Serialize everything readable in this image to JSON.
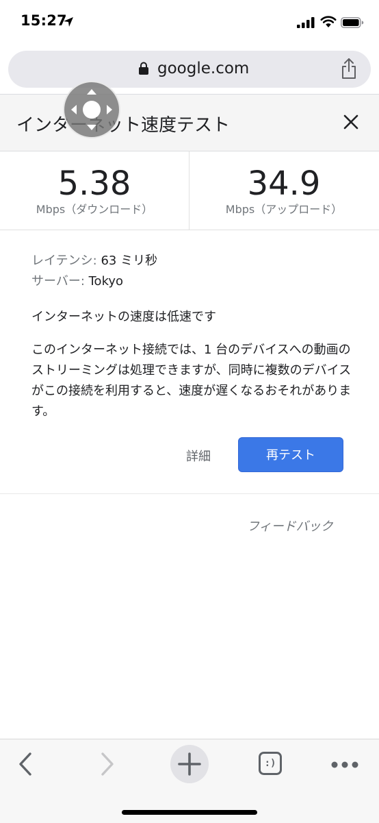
{
  "status_bar": {
    "time": "15:27"
  },
  "address_bar": {
    "url": "google.com"
  },
  "header": {
    "title": "インターネット速度テスト"
  },
  "speeds": {
    "download": {
      "value": "5.38",
      "label": "Mbps（ダウンロード）"
    },
    "upload": {
      "value": "34.9",
      "label": "Mbps（アップロード）"
    }
  },
  "info": {
    "latency_key": "レイテンシ:",
    "latency_value": "63 ミリ秒",
    "server_key": "サーバー:",
    "server_value": "Tokyo",
    "headline": "インターネットの速度は低速です",
    "description": "このインターネット接続では、1 台のデバイスへの動画のストリーミングは処理できますが、同時に複数のデバイスがこの接続を利用すると、速度が遅くなるおそれがあります。"
  },
  "actions": {
    "details_label": "詳細",
    "retest_label": "再テスト",
    "feedback_label": "フィードバック"
  },
  "toolbar": {
    "tab_count": ":)"
  },
  "colors": {
    "accent": "#3b78e7",
    "header_bg": "#f5f5f5",
    "address_bg": "#e8e8ed",
    "muted_text": "#70757a"
  },
  "icons": {
    "status": [
      "location-arrow-icon",
      "cellular-signal-icon",
      "wifi-icon",
      "battery-icon"
    ],
    "address": [
      "lock-icon",
      "share-icon"
    ],
    "header": [
      "close-icon",
      "dpad-icon"
    ],
    "toolbar": [
      "back-icon",
      "forward-icon",
      "new-tab-icon",
      "tab-switcher-icon",
      "more-icon"
    ]
  }
}
